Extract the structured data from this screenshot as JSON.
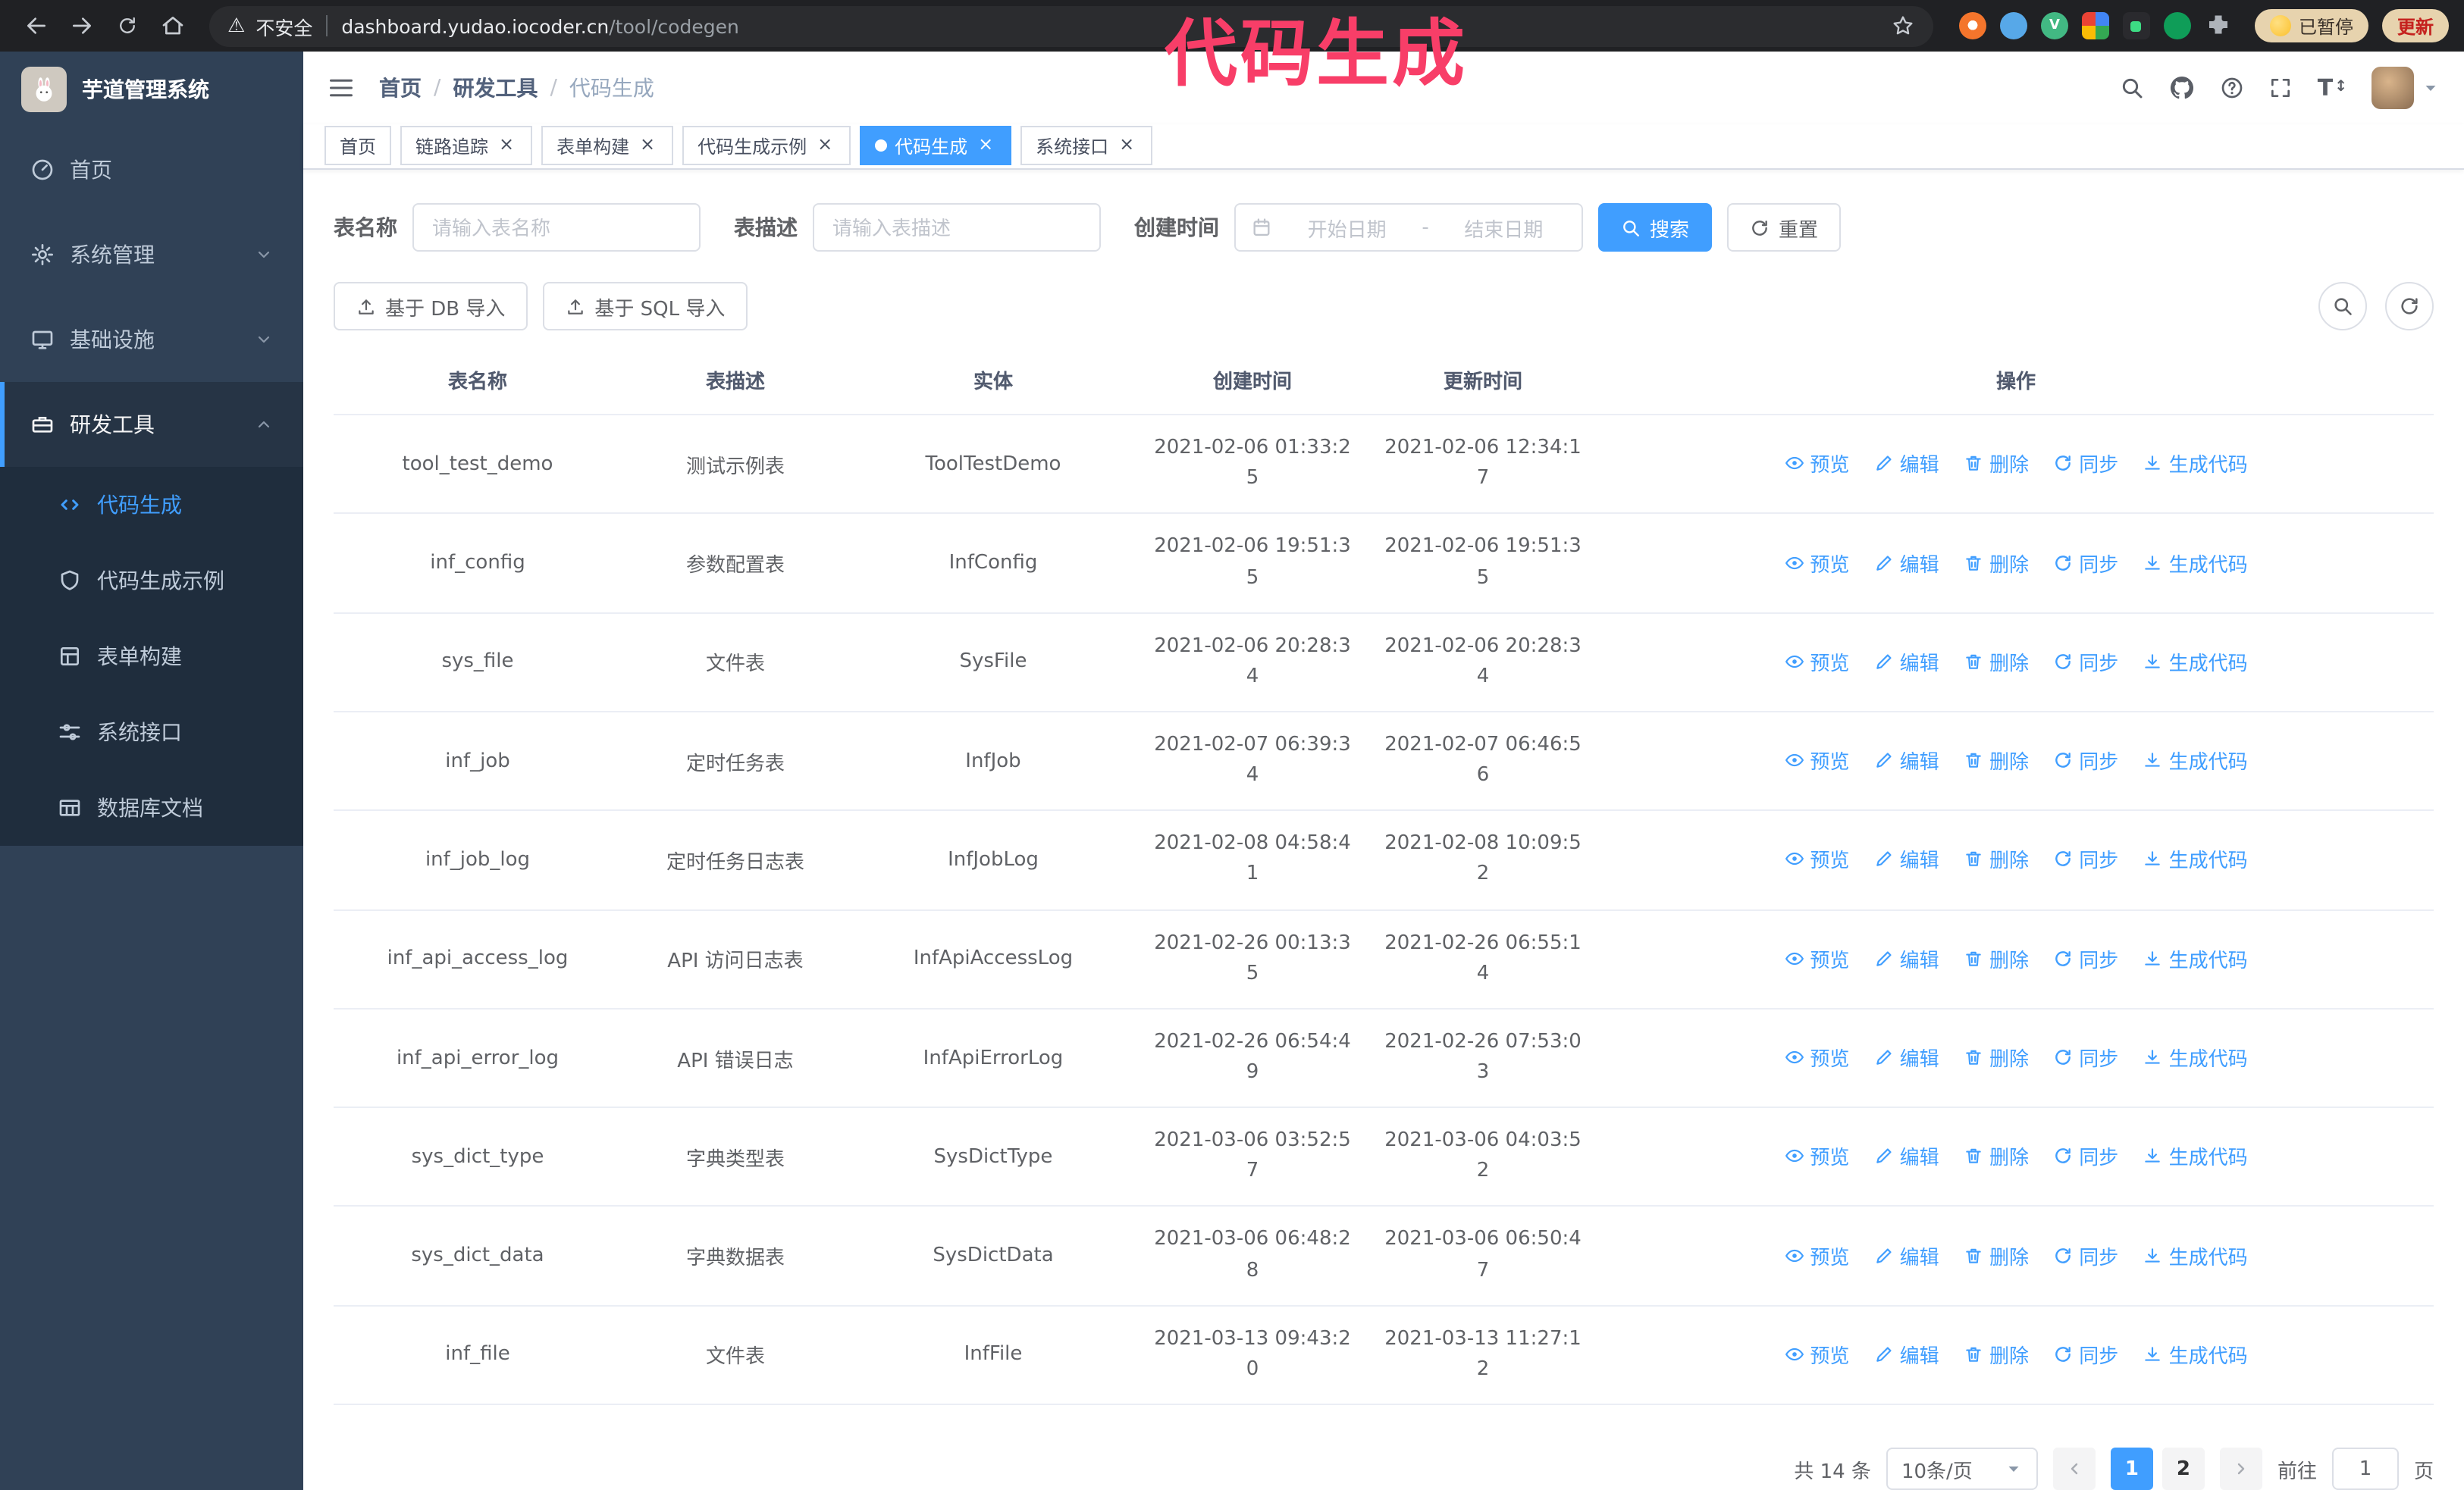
{
  "colors": {
    "primary": "#409eff",
    "annotation": "#f83e68",
    "sidebar_bg": "#304156",
    "active_tab_bg": "#409eff"
  },
  "icons": {
    "close": "×",
    "warning": "⚠",
    "font_size": "T",
    "updown": "↕"
  },
  "annotation": "代码生成",
  "browser": {
    "security_label": "不安全",
    "url_host": "dashboard.yudao.iocoder.cn",
    "url_path": "/tool/codegen",
    "paused_badge": "已暂停",
    "update_button": "更新"
  },
  "sidebar": {
    "title": "芋道管理系统",
    "items": [
      {
        "label": "首页"
      },
      {
        "label": "系统管理"
      },
      {
        "label": "基础设施"
      },
      {
        "label": "研发工具"
      }
    ],
    "subitems": [
      {
        "label": "代码生成",
        "active": true
      },
      {
        "label": "代码生成示例"
      },
      {
        "label": "表单构建"
      },
      {
        "label": "系统接口"
      },
      {
        "label": "数据库文档"
      }
    ]
  },
  "header": {
    "breadcrumb": [
      "首页",
      "研发工具",
      "代码生成"
    ],
    "breadcrumb_separator": "/"
  },
  "tabs": [
    {
      "label": "首页",
      "closable": false,
      "active": false
    },
    {
      "label": "链路追踪",
      "closable": true,
      "active": false
    },
    {
      "label": "表单构建",
      "closable": true,
      "active": false
    },
    {
      "label": "代码生成示例",
      "closable": true,
      "active": false
    },
    {
      "label": "代码生成",
      "closable": true,
      "active": true
    },
    {
      "label": "系统接口",
      "closable": true,
      "active": false
    }
  ],
  "filters": {
    "table_name_label": "表名称",
    "table_name_placeholder": "请输入表名称",
    "table_desc_label": "表描述",
    "table_desc_placeholder": "请输入表描述",
    "create_time_label": "创建时间",
    "date_start_placeholder": "开始日期",
    "date_separator": "-",
    "date_end_placeholder": "结束日期",
    "search_button": "搜索",
    "reset_button": "重置"
  },
  "toolbar": {
    "import_db": "基于 DB 导入",
    "import_sql": "基于 SQL 导入"
  },
  "table": {
    "columns": [
      "表名称",
      "表描述",
      "实体",
      "创建时间",
      "更新时间",
      "操作"
    ],
    "actions": [
      "预览",
      "编辑",
      "删除",
      "同步",
      "生成代码"
    ],
    "rows": [
      {
        "name": "tool_test_demo",
        "desc": "测试示例表",
        "entity": "ToolTestDemo",
        "created": "2021-02-06 01:33:25",
        "updated": "2021-02-06 12:34:17"
      },
      {
        "name": "inf_config",
        "desc": "参数配置表",
        "entity": "InfConfig",
        "created": "2021-02-06 19:51:35",
        "updated": "2021-02-06 19:51:35"
      },
      {
        "name": "sys_file",
        "desc": "文件表",
        "entity": "SysFile",
        "created": "2021-02-06 20:28:34",
        "updated": "2021-02-06 20:28:34"
      },
      {
        "name": "inf_job",
        "desc": "定时任务表",
        "entity": "InfJob",
        "created": "2021-02-07 06:39:34",
        "updated": "2021-02-07 06:46:56"
      },
      {
        "name": "inf_job_log",
        "desc": "定时任务日志表",
        "entity": "InfJobLog",
        "created": "2021-02-08 04:58:41",
        "updated": "2021-02-08 10:09:52"
      },
      {
        "name": "inf_api_access_log",
        "desc": "API 访问日志表",
        "entity": "InfApiAccessLog",
        "created": "2021-02-26 00:13:35",
        "updated": "2021-02-26 06:55:14"
      },
      {
        "name": "inf_api_error_log",
        "desc": "API 错误日志",
        "entity": "InfApiErrorLog",
        "created": "2021-02-26 06:54:49",
        "updated": "2021-02-26 07:53:03"
      },
      {
        "name": "sys_dict_type",
        "desc": "字典类型表",
        "entity": "SysDictType",
        "created": "2021-03-06 03:52:57",
        "updated": "2021-03-06 04:03:52"
      },
      {
        "name": "sys_dict_data",
        "desc": "字典数据表",
        "entity": "SysDictData",
        "created": "2021-03-06 06:48:28",
        "updated": "2021-03-06 06:50:47"
      },
      {
        "name": "inf_file",
        "desc": "文件表",
        "entity": "InfFile",
        "created": "2021-03-13 09:43:20",
        "updated": "2021-03-13 11:27:12"
      }
    ]
  },
  "pagination": {
    "total": "共 14 条",
    "page_size": "10条/页",
    "pages": [
      "1",
      "2"
    ],
    "active_page": "1",
    "goto_label": "前往",
    "goto_value": "1",
    "goto_suffix": "页"
  }
}
